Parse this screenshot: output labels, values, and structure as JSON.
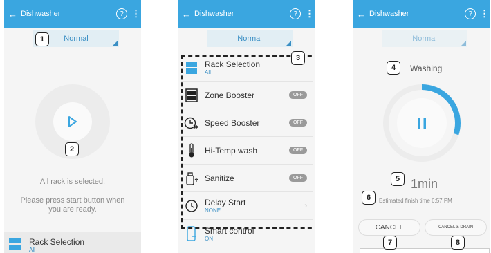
{
  "app": {
    "title": "Dishwasher",
    "help_icon": "?",
    "more_icon": "⋮",
    "back_icon": "←",
    "accent_color": "#3aa6e0"
  },
  "screen1": {
    "mode": "Normal",
    "badge1": "1",
    "badge2": "2",
    "message_line1": "All rack is selected.",
    "message_line2": "Please press start button when",
    "message_line3": "you are ready.",
    "rack": {
      "label": "Rack Selection",
      "value": "All"
    }
  },
  "screen2": {
    "mode": "Normal",
    "badge3": "3",
    "options": [
      {
        "label": "Rack Selection",
        "sub": "All",
        "icon": "rack-icon"
      },
      {
        "label": "Zone Booster",
        "toggle": "OFF",
        "icon": "zone-booster-icon"
      },
      {
        "label": "Speed Booster",
        "toggle": "OFF",
        "icon": "speed-booster-icon"
      },
      {
        "label": "Hi-Temp wash",
        "toggle": "OFF",
        "icon": "thermometer-icon"
      },
      {
        "label": "Sanitize",
        "toggle": "OFF",
        "icon": "sanitize-icon"
      },
      {
        "label": "Delay Start",
        "sub": "NONE",
        "icon": "clock-icon"
      },
      {
        "label": "Smart control",
        "sub": "ON",
        "icon": "phone-icon"
      }
    ]
  },
  "screen3": {
    "mode": "Normal",
    "status": "Washing",
    "time_left": "1min",
    "finish_time": "Estimated finish time 6:57 PM",
    "cancel_label": "CANCEL",
    "cancel_drain_label": "CANCEL & DRAIN",
    "progress": 0.3,
    "badge4": "4",
    "badge5": "5",
    "badge6": "6",
    "badge7": "7",
    "badge8": "8"
  }
}
